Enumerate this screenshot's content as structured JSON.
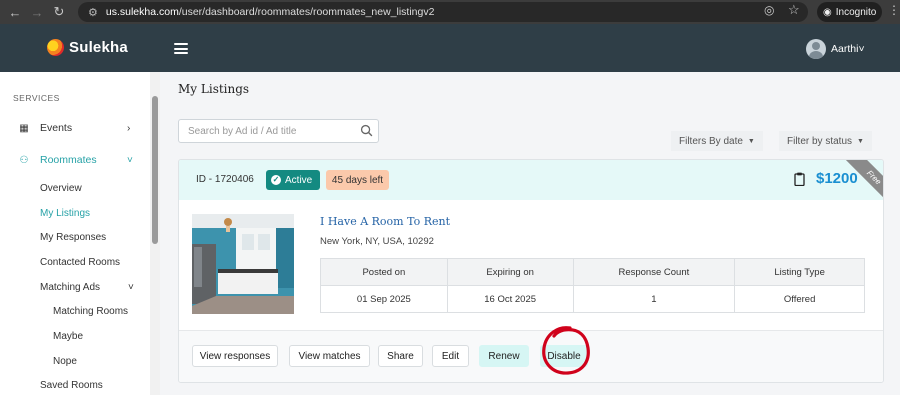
{
  "browser": {
    "url_host": "us.sulekha.com",
    "url_path": "/user/dashboard/roommates/roommates_new_listingv2",
    "incognito_label": "Incognito"
  },
  "header": {
    "brand": "Sulekha",
    "user_name": "Aarthi"
  },
  "sidebar": {
    "section_label": "SERVICES",
    "items": [
      {
        "label": "Events",
        "icon": "calendar-icon"
      },
      {
        "label": "Roommates",
        "icon": "people-icon"
      }
    ],
    "roommates_sub": [
      {
        "label": "Overview"
      },
      {
        "label": "My Listings",
        "active": true
      },
      {
        "label": "My Responses"
      },
      {
        "label": "Contacted Rooms"
      },
      {
        "label": "Matching Ads"
      }
    ],
    "matching_sub": [
      {
        "label": "Matching Rooms"
      },
      {
        "label": "Maybe"
      },
      {
        "label": "Nope"
      }
    ],
    "saved_rooms": "Saved Rooms"
  },
  "main": {
    "title": "My Listings",
    "search_placeholder": "Search by Ad id / Ad title",
    "filter_date": "Filters By date",
    "filter_status": "Filter by status"
  },
  "listing": {
    "id_label": "ID - 1720406",
    "status": "Active",
    "days_left": "45 days left",
    "price": "$1200",
    "ribbon": "Free",
    "title": "I Have A Room To Rent",
    "address": "New York, NY, USA, 10292",
    "table": {
      "headers": [
        "Posted on",
        "Expiring on",
        "Response Count",
        "Listing Type"
      ],
      "row": [
        "01 Sep 2025",
        "16 Oct 2025",
        "1",
        "Offered"
      ]
    },
    "actions": [
      "View responses",
      "View matches",
      "Share",
      "Edit",
      "Renew",
      "Disable"
    ]
  },
  "colors": {
    "header_bg": "#2f3e47",
    "accent_teal": "#27a2a7",
    "active_badge": "#148a81",
    "days_badge": "#fbc9ab",
    "price_blue": "#1a8fd1",
    "highlight_circle": "#d0021b"
  }
}
